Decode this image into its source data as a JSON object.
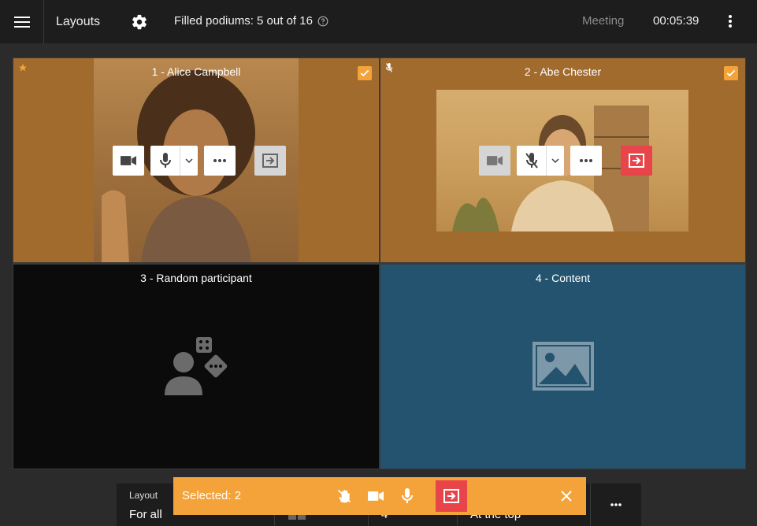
{
  "topbar": {
    "menu_icon": "hamburger-menu-icon",
    "title": "Layouts",
    "settings_icon": "gear-icon",
    "podiums_text": "Filled podiums: 5 out of 16",
    "help_icon": "help-circle-icon",
    "meeting_label": "Meeting",
    "timer": "00:05:39",
    "more_icon": "kebab-menu-icon"
  },
  "podiums": [
    {
      "label": "1 - Alice Campbell",
      "selected": true,
      "starred": true,
      "mic_muted": false
    },
    {
      "label": "2 - Abe Chester",
      "selected": true,
      "starred": false,
      "mic_muted": true
    },
    {
      "label": "3 - Random participant",
      "placeholder_icon": "random-participant-icon"
    },
    {
      "label": "4 - Content",
      "placeholder_icon": "image-icon"
    }
  ],
  "bottom": {
    "layout_label": "Layout",
    "layout_value": "For all",
    "count_value": "4",
    "position_value": "At the top"
  },
  "selection": {
    "text": "Selected: 2"
  },
  "colors": {
    "accent": "#f3a33a",
    "danger": "#e8454b",
    "selected_tile": "#a26b2e",
    "content_tile": "#24536f",
    "topbar": "#1d1d1d"
  }
}
